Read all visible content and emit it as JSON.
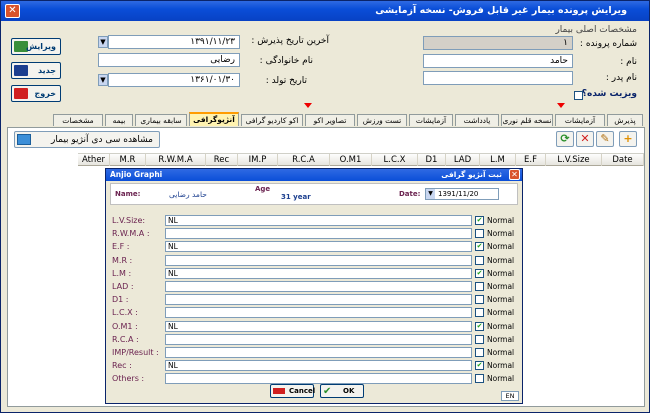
{
  "window": {
    "title": "ویرایش پرونده بیمار غیر قابل فروش- نسخه آزمایشی"
  },
  "section_title": "مشخصات اصلی بیمار",
  "fields": {
    "file_no_label": "شماره پرونده :",
    "file_no": "۱",
    "name_label": "نام :",
    "name": "حامد",
    "father_label": "نام پدر :",
    "father": "",
    "last_admit_label": "آخرین تاریخ پذیرش :",
    "last_admit": "۱۳۹۱/۱۱/۲۳",
    "family_label": "نام خانوادگی :",
    "family": "رضایی",
    "birth_label": "تاریخ تولد :",
    "birth": "۱۳۶۱/۰۱/۳۰",
    "visit_label": "ویزیت شده؟"
  },
  "side_buttons": [
    {
      "label": "ویرایش"
    },
    {
      "label": "جدید"
    },
    {
      "label": "خروج"
    }
  ],
  "tabs": [
    "پذیرش",
    "آزمایشات",
    "نسخه قلم نوری",
    "یادداشت",
    "آزمایشات",
    "تست ورزش",
    "تصاویر اکو",
    "اکو کاردیو گرافی",
    "آنژیوگرافی",
    "سابقه بیماری",
    "بیمه",
    "مشخصات"
  ],
  "active_tab": "آنژیوگرافی",
  "view_button": "مشاهده سی دی آنژیو بیمار",
  "grid_columns": [
    "Ather",
    "M.R",
    "R.W.M.A",
    "Rec",
    "IM.P",
    "R.C.A",
    "O.M1",
    "L.C.X",
    "D1",
    "LAD",
    "L.M",
    "E.F",
    "L.V.Size",
    "Date"
  ],
  "dialog": {
    "title_en": "Anjio Graphi",
    "title_fa": "ثبت آنژیو گرافی",
    "name_label": "Name:",
    "name": "حامد رضایی",
    "age_label": "Age",
    "age": "31 year",
    "date_label": "Date:",
    "date": "1391/11/20",
    "normal_label": "Normal",
    "rows": [
      {
        "label": "L.V.Size:",
        "value": "NL",
        "checked": true
      },
      {
        "label": "R.W.M.A :",
        "value": "",
        "checked": false
      },
      {
        "label": "E.F :",
        "value": "NL",
        "checked": true
      },
      {
        "label": "M.R :",
        "value": "",
        "checked": false
      },
      {
        "label": "L.M :",
        "value": "NL",
        "checked": true
      },
      {
        "label": "LAD :",
        "value": "",
        "checked": false
      },
      {
        "label": "D1 :",
        "value": "",
        "checked": false
      },
      {
        "label": "L.C.X :",
        "value": "",
        "checked": false
      },
      {
        "label": "O.M1 :",
        "value": "NL",
        "checked": true
      },
      {
        "label": "R.C.A :",
        "value": "",
        "checked": false
      },
      {
        "label": "IMP/Result :",
        "value": "",
        "checked": false
      },
      {
        "label": "Rec :",
        "value": "NL",
        "checked": true
      },
      {
        "label": "Others :",
        "value": "",
        "checked": false
      }
    ],
    "cancel": "Cancel",
    "ok": "OK",
    "lang": "EN"
  },
  "colors": {
    "title": "#0a4ed8",
    "active_tab": "#fff3b0",
    "label": "#6b2350"
  }
}
